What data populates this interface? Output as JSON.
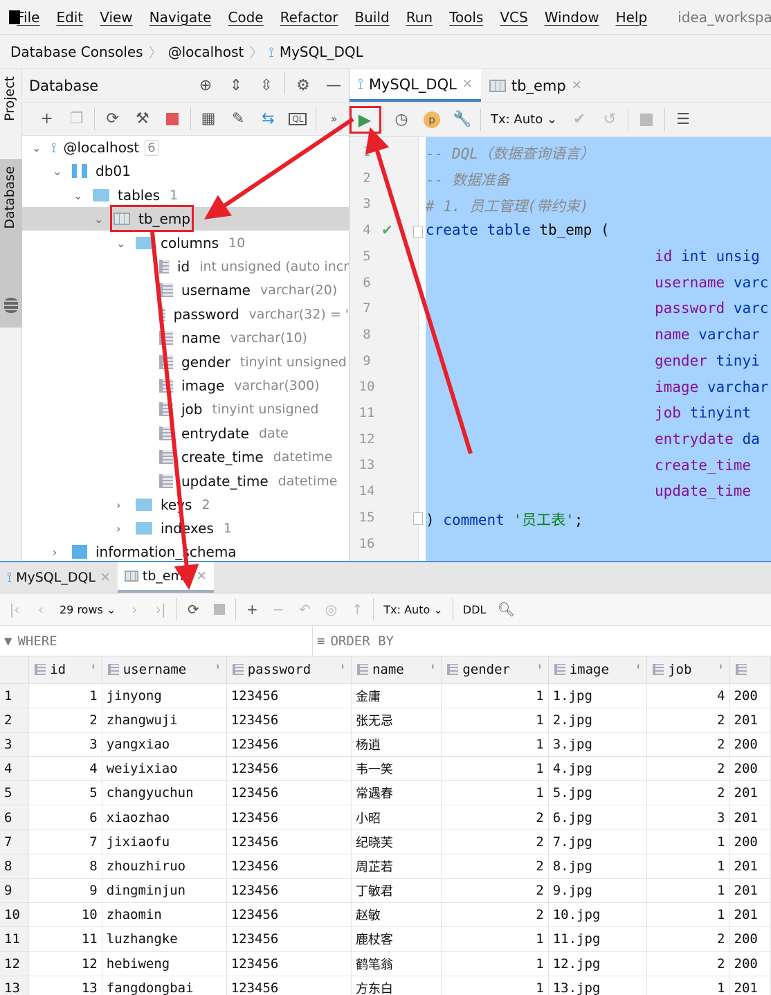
{
  "menu": {
    "items": [
      "File",
      "Edit",
      "View",
      "Navigate",
      "Code",
      "Refactor",
      "Build",
      "Run",
      "Tools",
      "VCS",
      "Window",
      "Help"
    ],
    "project": "idea_workspa"
  },
  "breadcrumb": [
    "Database Consoles",
    "@localhost",
    "MySQL_DQL"
  ],
  "side": {
    "project": "Project",
    "database": "Database"
  },
  "db_panel": {
    "title": "Database",
    "tree": {
      "host": "@localhost",
      "host_count": "6",
      "db": "db01",
      "tables": "tables",
      "tables_count": "1",
      "table": "tb_emp",
      "columns": "columns",
      "columns_count": "10",
      "cols": [
        {
          "n": "id",
          "t": "int unsigned (auto incr"
        },
        {
          "n": "username",
          "t": "varchar(20)"
        },
        {
          "n": "password",
          "t": "varchar(32) = '"
        },
        {
          "n": "name",
          "t": "varchar(10)"
        },
        {
          "n": "gender",
          "t": "tinyint unsigned"
        },
        {
          "n": "image",
          "t": "varchar(300)"
        },
        {
          "n": "job",
          "t": "tinyint unsigned"
        },
        {
          "n": "entrydate",
          "t": "date"
        },
        {
          "n": "create_time",
          "t": "datetime"
        },
        {
          "n": "update_time",
          "t": "datetime"
        }
      ],
      "keys": "keys",
      "keys_count": "2",
      "indexes": "indexes",
      "indexes_count": "1",
      "schema": "information_schema"
    }
  },
  "editor": {
    "tabs": [
      {
        "label": "MySQL_DQL"
      },
      {
        "label": "tb_emp"
      }
    ],
    "tx": "Tx: Auto",
    "lines": [
      "1",
      "2",
      "3",
      "4",
      "5",
      "6",
      "7",
      "8",
      "9",
      "10",
      "11",
      "12",
      "13",
      "14",
      "15",
      "16"
    ],
    "code": {
      "c1": "-- DQL（数据查询语言）",
      "c2": "-- 数据准备",
      "c3": "# 1. 员工管理(带约束)",
      "create": "create table",
      "tname": " tb_emp (",
      "fields": [
        [
          "id",
          "int unsig"
        ],
        [
          "username",
          "varc"
        ],
        [
          "password",
          "varc"
        ],
        [
          "name",
          "varchar"
        ],
        [
          "gender",
          "tinyi"
        ],
        [
          "image",
          "varchar"
        ],
        [
          "job",
          "tinyint"
        ],
        [
          "entrydate",
          "da"
        ],
        [
          "create_time",
          ""
        ],
        [
          "update_time",
          ""
        ]
      ],
      "close": ") ",
      "comment": "comment",
      "cstr": "'员工表'",
      "semi": ";"
    }
  },
  "results": {
    "tabs": [
      {
        "label": "MySQL_DQL"
      },
      {
        "label": "tb_emp"
      }
    ],
    "rows_label": "29 rows",
    "tx": "Tx: Auto",
    "ddl": "DDL",
    "where": "WHERE",
    "order_by": "ORDER BY",
    "columns": [
      "id",
      "username",
      "password",
      "name",
      "gender",
      "image",
      "job",
      ""
    ],
    "rows": [
      [
        "1",
        "1",
        "jinyong",
        "123456",
        "金庸",
        "1",
        "1.jpg",
        "4",
        "200"
      ],
      [
        "2",
        "2",
        "zhangwuji",
        "123456",
        "张无忌",
        "1",
        "2.jpg",
        "2",
        "201"
      ],
      [
        "3",
        "3",
        "yangxiao",
        "123456",
        "杨逍",
        "1",
        "3.jpg",
        "2",
        "200"
      ],
      [
        "4",
        "4",
        "weiyixiao",
        "123456",
        "韦一笑",
        "1",
        "4.jpg",
        "2",
        "200"
      ],
      [
        "5",
        "5",
        "changyuchun",
        "123456",
        "常遇春",
        "1",
        "5.jpg",
        "2",
        "201"
      ],
      [
        "6",
        "6",
        "xiaozhao",
        "123456",
        "小昭",
        "2",
        "6.jpg",
        "3",
        "201"
      ],
      [
        "7",
        "7",
        "jixiaofu",
        "123456",
        "纪晓芙",
        "2",
        "7.jpg",
        "1",
        "200"
      ],
      [
        "8",
        "8",
        "zhouzhiruo",
        "123456",
        "周芷若",
        "2",
        "8.jpg",
        "1",
        "201"
      ],
      [
        "9",
        "9",
        "dingminjun",
        "123456",
        "丁敏君",
        "2",
        "9.jpg",
        "1",
        "201"
      ],
      [
        "10",
        "10",
        "zhaomin",
        "123456",
        "赵敏",
        "2",
        "10.jpg",
        "1",
        "201"
      ],
      [
        "11",
        "11",
        "luzhangke",
        "123456",
        "鹿杖客",
        "1",
        "11.jpg",
        "2",
        "200"
      ],
      [
        "12",
        "12",
        "hebiweng",
        "123456",
        "鹤笔翁",
        "1",
        "12.jpg",
        "2",
        "200"
      ],
      [
        "13",
        "13",
        "fangdongbai",
        "123456",
        "方东白",
        "1",
        "13.jpg",
        "1",
        "201"
      ]
    ]
  },
  "colors": {
    "annotation": "#e8202a",
    "selection": "#a6d2ff",
    "run": "#3d9a50"
  }
}
